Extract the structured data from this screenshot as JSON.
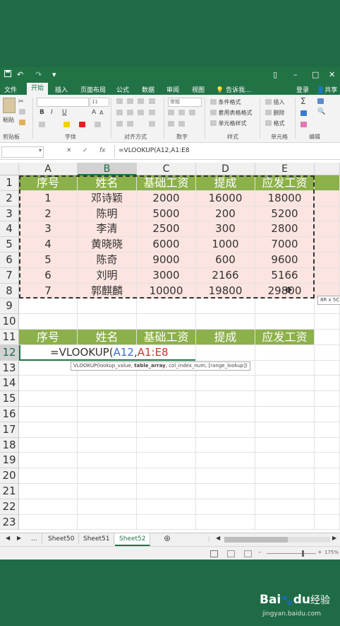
{
  "quick_access": {
    "save_icon": "save-icon",
    "undo": "↶",
    "redo": "↷",
    "more": "▾"
  },
  "window_controls": {
    "restore": "▯",
    "minimize": "–",
    "maximize": "□",
    "close": "✕"
  },
  "ribbon_tabs": [
    "文件",
    "开始",
    "插入",
    "页面布局",
    "公式",
    "数据",
    "审阅",
    "视图"
  ],
  "active_tab": "开始",
  "tell_me": "告诉我...",
  "signin": "登录",
  "share": "共享",
  "ribbon": {
    "paste_label": "粘贴",
    "font_size": "11",
    "number_format": "常规",
    "cond_format": "条件格式",
    "table_format": "套用表格格式",
    "cell_style": "单元格样式",
    "insert": "插入",
    "delete": "删除",
    "format": "格式",
    "groups": {
      "clipboard": "剪贴板",
      "font": "字体",
      "alignment": "对齐方式",
      "number": "数字",
      "styles": "样式",
      "cells": "单元格",
      "editing": "编辑"
    }
  },
  "formula_bar": {
    "name_box": "",
    "cancel": "✕",
    "confirm": "✓",
    "fx": "fx",
    "formula": "=VLOOKUP(A12,A1:E8"
  },
  "columns": [
    "A",
    "B",
    "C",
    "D",
    "E"
  ],
  "rows": [
    "1",
    "2",
    "3",
    "4",
    "5",
    "6",
    "7",
    "8",
    "9",
    "10",
    "11",
    "12",
    "13",
    "14",
    "15",
    "16",
    "17",
    "18",
    "19",
    "20",
    "21",
    "22",
    "23"
  ],
  "table1": {
    "headers": [
      "序号",
      "姓名",
      "基础工资",
      "提成",
      "应发工资"
    ],
    "data": [
      [
        "1",
        "邓诗颖",
        "2000",
        "16000",
        "18000"
      ],
      [
        "2",
        "陈明",
        "5000",
        "200",
        "5200"
      ],
      [
        "3",
        "李清",
        "2500",
        "300",
        "2800"
      ],
      [
        "4",
        "黄晓晓",
        "6000",
        "1000",
        "7000"
      ],
      [
        "5",
        "陈奇",
        "9000",
        "600",
        "9600"
      ],
      [
        "6",
        "刘明",
        "3000",
        "2166",
        "5166"
      ],
      [
        "7",
        "郭麒麟",
        "10000",
        "19800",
        "29800"
      ]
    ]
  },
  "range_size_tip": "8R x 5C",
  "table2_headers": [
    "序号",
    "姓名",
    "基础工资",
    "提成",
    "应发工资"
  ],
  "active_formula": {
    "prefix": "=VLOOKUP(",
    "ref1": "A12",
    ",": ",",
    "ref2": "A1:E8"
  },
  "function_tooltip": {
    "fn": "VLOOKUP(lookup_value, ",
    "bold": "table_array",
    ",rest": ", col_index_num, [range_lookup])"
  },
  "sheets": [
    "...",
    "Sheet50",
    "Sheet51",
    "Sheet52"
  ],
  "active_sheet": "Sheet52",
  "add_sheet": "⊕",
  "zoom": "175%",
  "watermark": {
    "brand": "Bai",
    "paw": "du",
    "cn": "经验",
    "url": "jingyan.baidu.com"
  }
}
